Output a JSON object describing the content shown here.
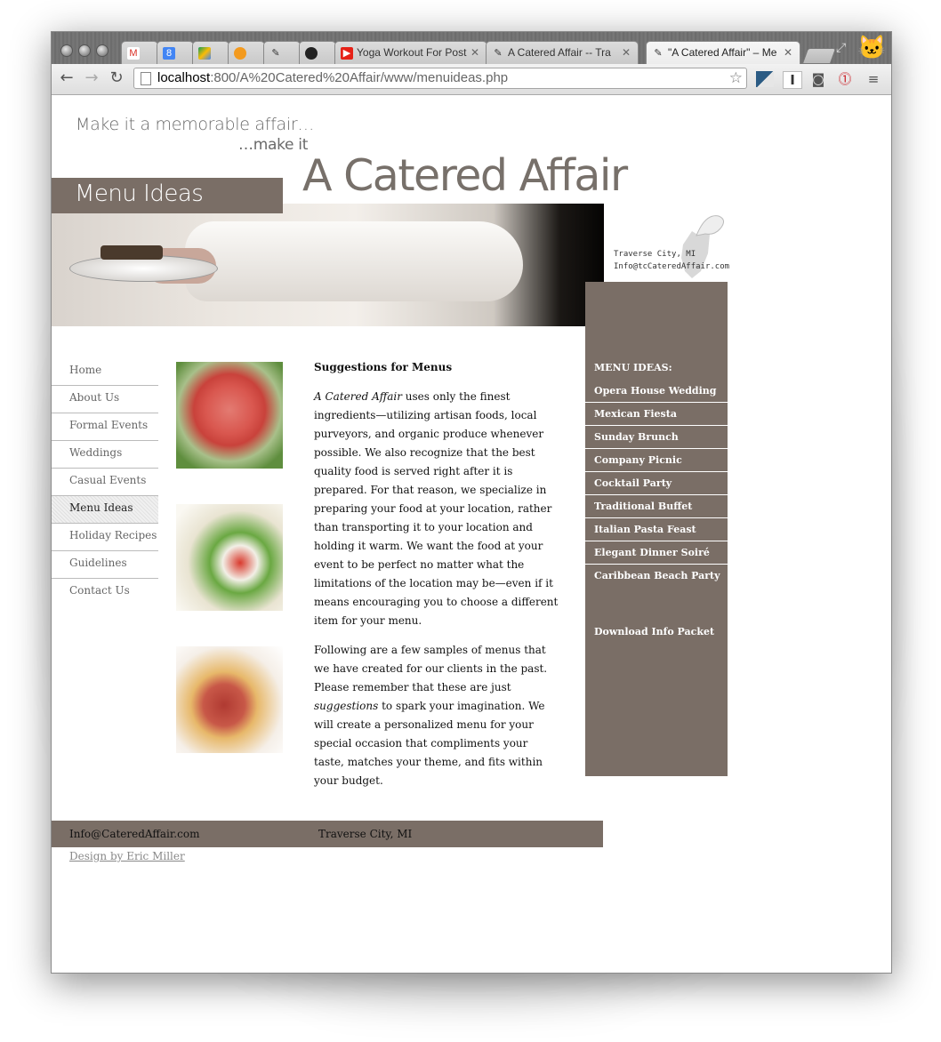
{
  "browser": {
    "tabs": [
      {
        "label": "",
        "icon": "gmail-icon"
      },
      {
        "label": "",
        "icon": "calendar-icon"
      },
      {
        "label": "",
        "icon": "drive-icon"
      },
      {
        "label": "",
        "icon": "orange-circle-icon"
      },
      {
        "label": "",
        "icon": "recipe-icon"
      },
      {
        "label": "",
        "icon": "github-icon"
      },
      {
        "label": "Yoga Workout For Post",
        "icon": "youtube-icon"
      },
      {
        "label": "A Catered Affair -- Tra",
        "icon": "recipe-icon"
      },
      {
        "label": "\"A Catered Affair\" – Me",
        "icon": "recipe-icon"
      }
    ],
    "url_host": "localhost",
    "url_rest": ":800/A%20Catered%20Affair/www/menuideas.php"
  },
  "header": {
    "tagline_1": "Make it a memorable affair…",
    "tagline_2": "…make it",
    "site_title": "A Catered Affair",
    "page_title": "Menu Ideas",
    "location": "Traverse City, MI",
    "email_top": "Info@tcCateredAffair.com"
  },
  "left_nav": [
    {
      "label": "Home"
    },
    {
      "label": "About Us"
    },
    {
      "label": "Formal Events"
    },
    {
      "label": "Weddings"
    },
    {
      "label": "Casual Events"
    },
    {
      "label": "Menu Ideas",
      "active": true
    },
    {
      "label": "Holiday Recipes"
    },
    {
      "label": "Guidelines"
    },
    {
      "label": "Contact Us"
    }
  ],
  "main": {
    "heading": "Suggestions for Menus",
    "p1_italic": "A Catered Affair",
    "p1_rest": " uses only the finest ingredients—utilizing artisan foods, local purveyors, and organic produce whenever possible. We also recognize that the best quality food is served right after it is prepared. For that reason, we specialize in preparing your food at your location, rather than transporting it to your location and holding it warm. We want the food at your event to be perfect no matter what the limitations of the location may be—even if it means encouraging you to choose a different item for your menu.",
    "p2_start": "Following are a few samples of menus that we have created for our clients in the past. Please remember that these are just ",
    "p2_italic": "suggestions",
    "p2_end": " to spark your imagination. We will create a personalized menu for your special occasion that compliments your taste, matches your theme, and fits within your budget."
  },
  "right_col": {
    "title": "MENU IDEAS:",
    "items": [
      "Opera House Wedding",
      "Mexican Fiesta",
      "Sunday Brunch",
      "Company Picnic",
      "Cocktail Party",
      "Traditional Buffet",
      "Italian Pasta Feast",
      "Elegant Dinner Soiré",
      "Caribbean Beach Party"
    ],
    "download": "Download Info Packet"
  },
  "footer": {
    "email": "Info@CateredAffair.com",
    "location": "Traverse City, MI",
    "credit": "Design by Eric Miller"
  },
  "colors": {
    "brand_taupe": "#7a6e66",
    "text_grey": "#6a6a6a"
  }
}
